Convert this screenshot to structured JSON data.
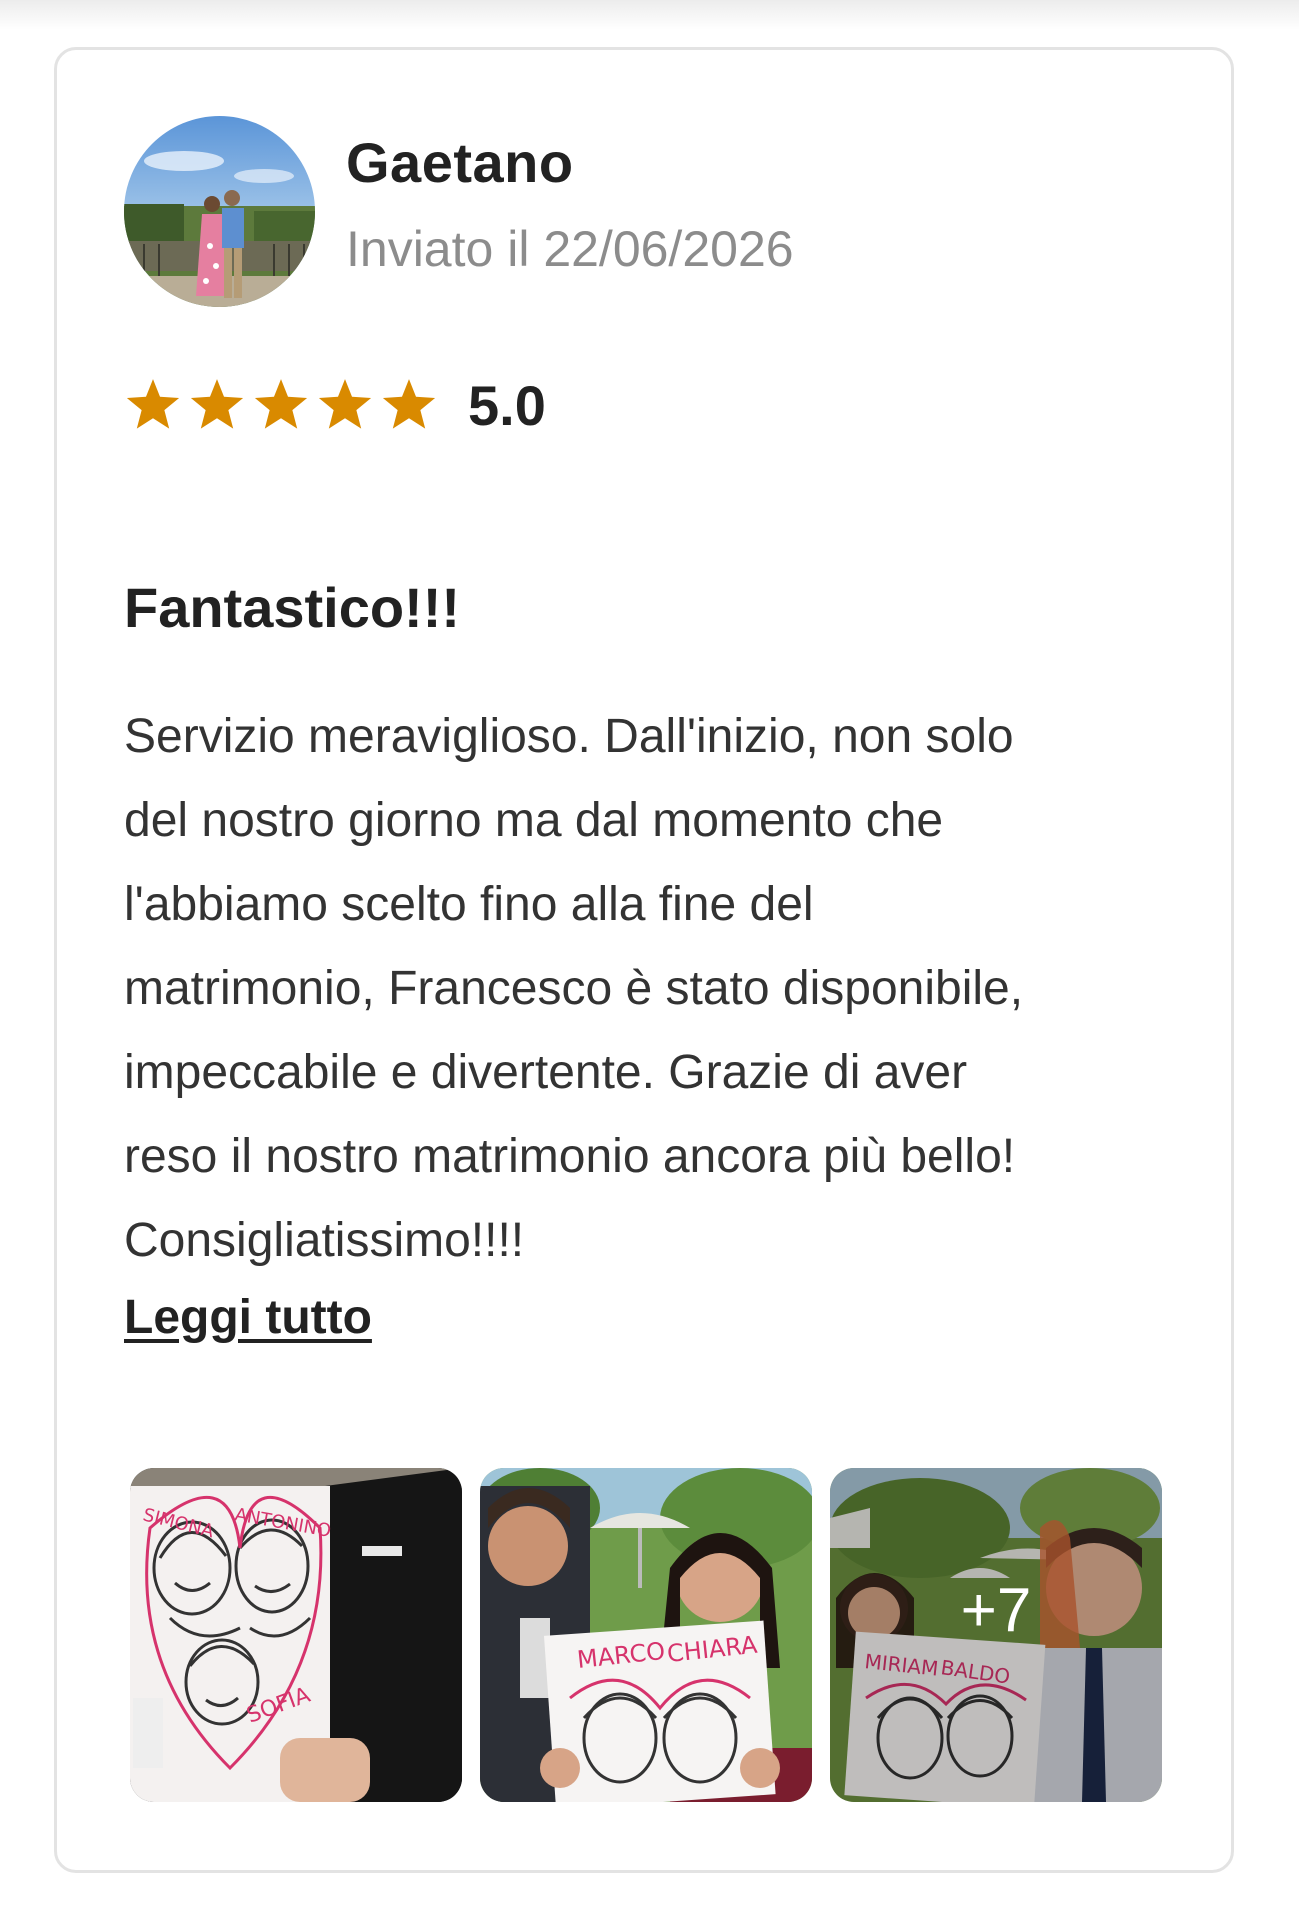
{
  "review": {
    "author": "Gaetano",
    "date": "Inviato il 22/06/2026",
    "rating": 5,
    "rating_text": "5.0",
    "title": "Fantastico!!!",
    "body_lines": [
      "Servizio meraviglioso. Dall'inizio, non solo",
      "del nostro giorno ma dal momento che",
      "l'abbiamo scelto fino alla fine del",
      "matrimonio, Francesco è stato disponibile,",
      "impeccabile e divertente. Grazie di aver",
      "reso il nostro matrimonio ancora più bello!",
      "Consigliatissimo!!!!"
    ],
    "read_more": "Leggi tutto"
  },
  "photos": {
    "caricature_names": [
      [
        "SIMONA",
        "ANTONINO",
        "SOFIA"
      ],
      [
        "MARCO",
        "CHIARA"
      ],
      [
        "MIRIAM",
        "BALDO"
      ]
    ],
    "more_count": "+7"
  },
  "colors": {
    "star": "#d98a00",
    "muted_text": "#8c8c8c",
    "card_border": "#e3e3e3"
  },
  "icons": {
    "star": "star-icon"
  }
}
